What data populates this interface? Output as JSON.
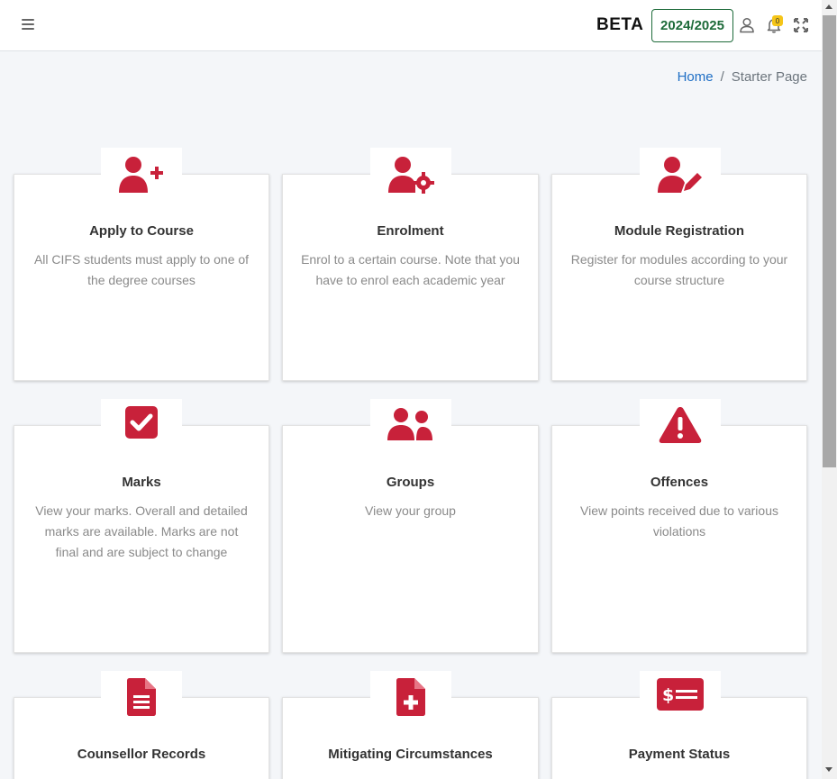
{
  "header": {
    "menu_icon": "hamburger-icon",
    "beta_label": "BETA",
    "year_label": "2024/2025",
    "user_icon": "user-icon",
    "bell_icon": "bell-icon",
    "notification_count": "0",
    "expand_icon": "expand-icon"
  },
  "breadcrumb": {
    "home": "Home",
    "separator": "/",
    "current": "Starter Page"
  },
  "colors": {
    "accent": "#c8213a",
    "year_green": "#1e6b3a",
    "link_blue": "#1f6fc5"
  },
  "cards": [
    {
      "title": "Apply to Course",
      "description": "All CIFS students must apply to one of the degree courses",
      "icon": "user-plus-icon"
    },
    {
      "title": "Enrolment",
      "description": "Enrol to a certain course. Note that you have to enrol each academic year",
      "icon": "user-gear-icon"
    },
    {
      "title": "Module Registration",
      "description": "Register for modules according to your course structure",
      "icon": "user-pen-icon"
    },
    {
      "title": "Marks",
      "description": "View your marks. Overall and detailed marks are available. Marks are not final and are subject to change",
      "icon": "square-check-icon"
    },
    {
      "title": "Groups",
      "description": "View your group",
      "icon": "user-group-icon"
    },
    {
      "title": "Offences",
      "description": "View points received due to various violations",
      "icon": "warning-triangle-icon"
    },
    {
      "title": "Counsellor Records",
      "description": "",
      "icon": "file-lines-icon"
    },
    {
      "title": "Mitigating Circumstances",
      "description": "",
      "icon": "file-medical-icon"
    },
    {
      "title": "Payment Status",
      "description": "",
      "icon": "money-check-icon"
    }
  ]
}
